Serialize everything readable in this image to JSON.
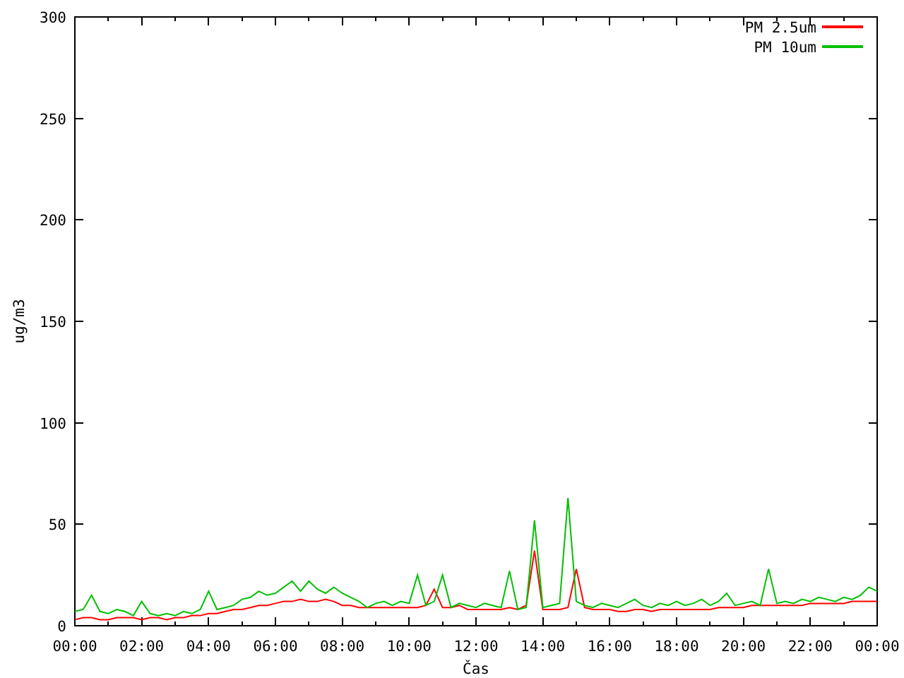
{
  "chart_data": {
    "type": "line",
    "xlabel": "Čas",
    "ylabel": "ug/m3",
    "x": [
      0,
      0.25,
      0.5,
      0.75,
      1,
      1.25,
      1.5,
      1.75,
      2,
      2.25,
      2.5,
      2.75,
      3,
      3.25,
      3.5,
      3.75,
      4,
      4.25,
      4.5,
      4.75,
      5,
      5.25,
      5.5,
      5.75,
      6,
      6.25,
      6.5,
      6.75,
      7,
      7.25,
      7.5,
      7.75,
      8,
      8.25,
      8.5,
      8.75,
      9,
      9.25,
      9.5,
      9.75,
      10,
      10.25,
      10.5,
      10.75,
      11,
      11.25,
      11.5,
      11.75,
      12,
      12.25,
      12.5,
      12.75,
      13,
      13.25,
      13.5,
      13.75,
      14,
      14.25,
      14.5,
      14.75,
      15,
      15.25,
      15.5,
      15.75,
      16,
      16.25,
      16.5,
      16.75,
      17,
      17.25,
      17.5,
      17.75,
      18,
      18.25,
      18.5,
      18.75,
      19,
      19.25,
      19.5,
      19.75,
      20,
      20.25,
      20.5,
      20.75,
      21,
      21.25,
      21.5,
      21.75,
      22,
      22.25,
      22.5,
      22.75,
      23,
      23.25,
      23.5,
      23.75,
      24
    ],
    "series": [
      {
        "name": "PM 2.5um",
        "color": "#ff0000",
        "values": [
          3,
          4,
          4,
          3,
          3,
          4,
          4,
          4,
          3,
          4,
          4,
          3,
          4,
          4,
          5,
          5,
          6,
          6,
          7,
          8,
          8,
          9,
          10,
          10,
          11,
          12,
          12,
          13,
          12,
          12,
          13,
          12,
          10,
          10,
          9,
          9,
          9,
          9,
          9,
          9,
          9,
          9,
          10,
          18,
          9,
          9,
          10,
          8,
          8,
          8,
          8,
          8,
          9,
          8,
          10,
          37,
          8,
          8,
          8,
          9,
          28,
          9,
          8,
          8,
          8,
          7,
          7,
          8,
          8,
          7,
          8,
          8,
          8,
          8,
          8,
          8,
          8,
          9,
          9,
          9,
          9,
          10,
          10,
          10,
          10,
          10,
          10,
          10,
          11,
          11,
          11,
          11,
          11,
          12,
          12,
          12,
          12
        ]
      },
      {
        "name": "PM 10um",
        "color": "#00c000",
        "values": [
          7,
          8,
          15,
          7,
          6,
          8,
          7,
          5,
          12,
          6,
          5,
          6,
          5,
          7,
          6,
          8,
          17,
          8,
          9,
          10,
          13,
          14,
          17,
          15,
          16,
          19,
          22,
          17,
          22,
          18,
          16,
          19,
          16,
          14,
          12,
          9,
          11,
          12,
          10,
          12,
          11,
          25,
          10,
          12,
          25,
          9,
          11,
          10,
          9,
          11,
          10,
          9,
          27,
          8,
          9,
          52,
          9,
          10,
          11,
          63,
          12,
          10,
          9,
          11,
          10,
          9,
          11,
          13,
          10,
          9,
          11,
          10,
          12,
          10,
          11,
          13,
          10,
          12,
          16,
          10,
          11,
          12,
          10,
          28,
          11,
          12,
          11,
          13,
          12,
          14,
          13,
          12,
          14,
          13,
          15,
          19,
          17
        ]
      }
    ],
    "legend": "upper right",
    "xlim": [
      0,
      24
    ],
    "ylim": [
      0,
      300
    ],
    "xticks": [
      {
        "value": 0,
        "label": "00:00"
      },
      {
        "value": 2,
        "label": "02:00"
      },
      {
        "value": 4,
        "label": "04:00"
      },
      {
        "value": 6,
        "label": "06:00"
      },
      {
        "value": 8,
        "label": "08:00"
      },
      {
        "value": 10,
        "label": "10:00"
      },
      {
        "value": 12,
        "label": "12:00"
      },
      {
        "value": 14,
        "label": "14:00"
      },
      {
        "value": 16,
        "label": "16:00"
      },
      {
        "value": 18,
        "label": "18:00"
      },
      {
        "value": 20,
        "label": "20:00"
      },
      {
        "value": 22,
        "label": "22:00"
      },
      {
        "value": 24,
        "label": "00:00"
      }
    ],
    "yticks": [
      0,
      50,
      100,
      150,
      200,
      250,
      300
    ]
  }
}
